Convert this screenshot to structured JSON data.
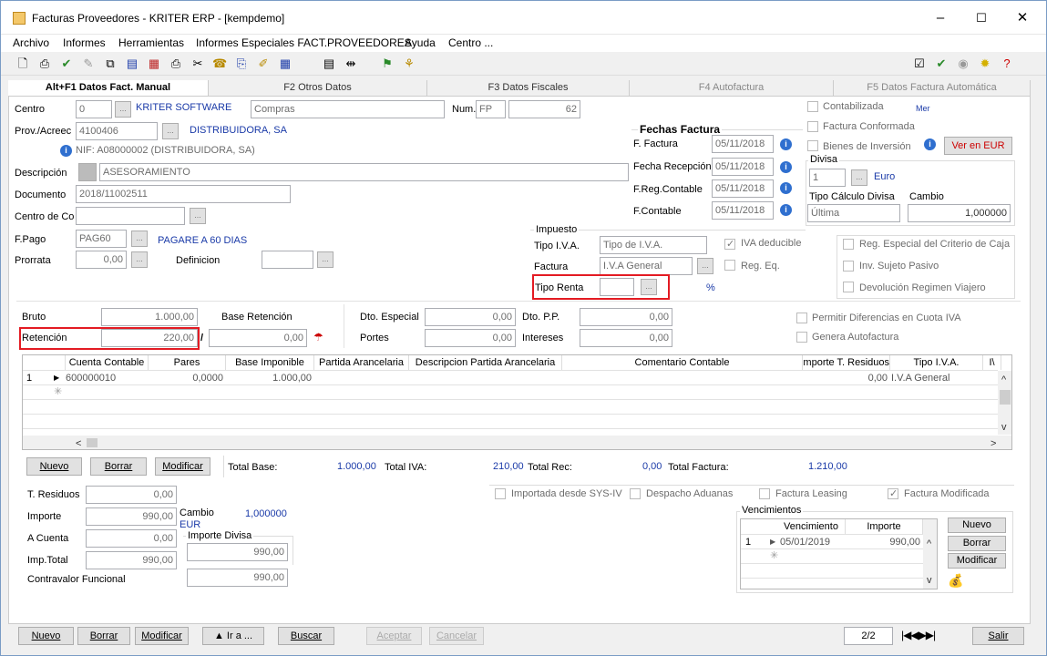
{
  "window": {
    "title": "Facturas Proveedores  - KRITER ERP - [kempdemo]",
    "min": "–",
    "max": "☐",
    "close": "✕"
  },
  "menu": [
    "Archivo",
    "Informes",
    "Herramientas",
    "Informes Especiales FACT.PROVEEDORES",
    "Ayuda",
    "Centro ..."
  ],
  "tabs": [
    "Alt+F1 Datos Fact. Manual",
    "F2 Otros Datos",
    "F3 Datos Fiscales",
    "F4 Autofactura",
    "F5 Datos Factura Automática"
  ],
  "form": {
    "centro_label": "Centro",
    "centro_value": "0",
    "centro_name": "KRITER SOFTWARE",
    "compras": "Compras",
    "num_label": "Num.",
    "num_serie": "FP",
    "num_value": "62",
    "prov_label": "Prov./Acreec",
    "prov_value": "4100406",
    "prov_name": "DISTRIBUIDORA, SA",
    "nif_text": "NIF:  A08000002 (DISTRIBUIDORA, SA)",
    "descripcion_label": "Descripción",
    "descripcion_value": "ASESORAMIENTO",
    "documento_label": "Documento",
    "documento_value": "2018/11002511",
    "centroco_label": "Centro de Co",
    "fpago_label": "F.Pago",
    "fpago_value": "PAG60",
    "fpago_name": "PAGARE A 60 DIAS",
    "prorrata_label": "Prorrata",
    "prorrata_value": "0,00",
    "definicion_label": "Definicion"
  },
  "fechas": {
    "title": "Fechas Factura",
    "f_factura_label": "F. Factura",
    "f_factura": "05/11/2018",
    "f_recepcion_label": "Fecha Recepción",
    "f_recepcion": "05/11/2018",
    "f_regcont_label": "F.Reg.Contable",
    "f_regcont": "05/11/2018",
    "f_contable_label": "F.Contable",
    "f_contable": "05/11/2018"
  },
  "flags": {
    "contabilizada": "Contabilizada",
    "conformada": "Factura Conformada",
    "bienes": "Bienes de Inversión",
    "ver_eur": "Ver en EUR",
    "mer": "Mer"
  },
  "divisa": {
    "title": "Divisa",
    "value": "1",
    "name": "Euro",
    "tipo_label": "Tipo Cálculo Divisa",
    "tipo_value": "Última",
    "cambio_label": "Cambio",
    "cambio_value": "1,000000"
  },
  "impuesto": {
    "title": "Impuesto",
    "tipo_iva_label": "Tipo I.V.A.",
    "tipo_iva_value": "Tipo de I.V.A.",
    "iva_deducible": "IVA deducible",
    "factura_label": "Factura",
    "factura_value": "I.V.A General",
    "reg_eq": "Reg. Eq.",
    "tipo_renta_label": "Tipo Renta",
    "percent": "%",
    "reg_especial": "Reg. Especial del Criterio de Caja",
    "inv_sujeto": "Inv. Sujeto Pasivo",
    "devolucion": "Devolución Regimen Viajero"
  },
  "totals": {
    "bruto_label": "Bruto",
    "bruto": "1.000,00",
    "base_ret_label": "Base Retención",
    "retencion_label": "Retención",
    "retencion": "220,00",
    "slash": "/",
    "base_ret": "0,00",
    "dto_especial_label": "Dto. Especial",
    "dto_especial": "0,00",
    "dto_pp_label": "Dto. P.P.",
    "dto_pp": "0,00",
    "portes_label": "Portes",
    "portes": "0,00",
    "intereses_label": "Intereses",
    "intereses": "0,00",
    "permitir": "Permitir Diferencias en Cuota IVA",
    "genera_auto": "Genera Autofactura"
  },
  "grid": {
    "headers": [
      "Cuenta Contable",
      "Pares",
      "Base Imponible",
      "Partida Arancelaria",
      "Descripcion Partida Arancelaria",
      "Comentario Contable",
      "mporte T. Residuos",
      "Tipo I.V.A.",
      "I\\"
    ],
    "row": {
      "num": "1",
      "cuenta": "600000010",
      "pares": "0,0000",
      "base": "1.000,00",
      "residuos": "0,00",
      "tipo_iva": "I.V.A General"
    },
    "new_row_marker": "✳"
  },
  "actions": {
    "nuevo": "Nuevo",
    "borrar": "Borrar",
    "modificar": "Modificar"
  },
  "summary": {
    "total_base_label": "Total Base:",
    "total_base": "1.000,00",
    "total_iva_label": "Total IVA:",
    "total_iva": "210,00",
    "total_rec_label": "Total Rec:",
    "total_rec": "0,00",
    "total_factura_label": "Total Factura:",
    "total_factura": "1.210,00"
  },
  "lower": {
    "t_residuos_label": "T. Residuos",
    "t_residuos": "0,00",
    "importe_label": "Importe",
    "importe": "990,00",
    "cambio_label": "Cambio",
    "cambio": "1,000000",
    "eur": "EUR",
    "a_cuenta_label": "A Cuenta",
    "a_cuenta": "0,00",
    "importe_divisa_label": "Importe Divisa",
    "importe_divisa": "990,00",
    "imp_total_label": "Imp.Total",
    "imp_total": "990,00",
    "contravalor_label": "Contravalor Funcional",
    "contravalor": "990,00",
    "importada": "Importada desde SYS-IV",
    "despacho": "Despacho Aduanas",
    "leasing": "Factura Leasing",
    "modificada": "Factura Modificada"
  },
  "vencimientos": {
    "title": "Vencimientos",
    "h_venc": "Vencimiento",
    "h_imp": "Importe",
    "num": "1",
    "fecha": "05/01/2019",
    "importe": "990,00",
    "nuevo": "Nuevo",
    "borrar": "Borrar",
    "modificar": "Modificar"
  },
  "bottom": {
    "nuevo": "Nuevo",
    "borrar": "Borrar",
    "modificar": "Modificar",
    "ira": "▲ Ir a ...",
    "buscar": "Buscar",
    "aceptar": "Aceptar",
    "cancelar": "Cancelar",
    "page": "2/2",
    "salir": "Salir"
  }
}
